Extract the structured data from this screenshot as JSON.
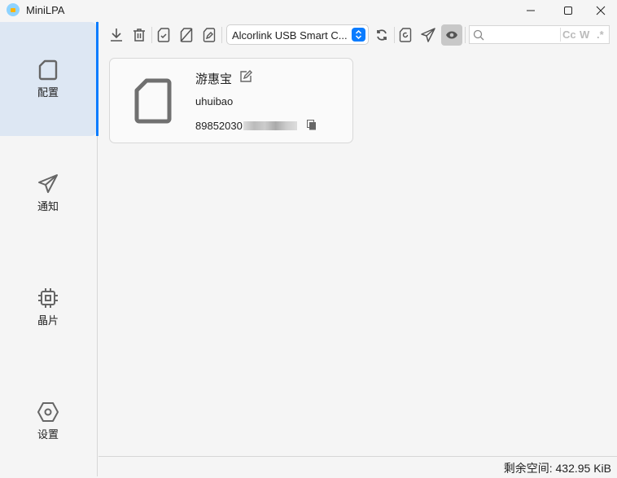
{
  "app": {
    "title": "MiniLPA"
  },
  "sidebar": {
    "items": [
      {
        "label": "配置",
        "icon": "sim-card-icon",
        "active": true
      },
      {
        "label": "通知",
        "icon": "send-icon"
      },
      {
        "label": "晶片",
        "icon": "chip-icon"
      },
      {
        "label": "设置",
        "icon": "settings-icon"
      }
    ]
  },
  "toolbar": {
    "reader": "Alcorlink USB Smart C...",
    "search_placeholder": "",
    "search_options": [
      "Cc",
      "W",
      ".*"
    ]
  },
  "profile": {
    "nickname": "游惠宝",
    "provider": "uhuibao",
    "iccid": "89852030"
  },
  "status": {
    "label": "剩余空间:",
    "value": "432.95 KiB"
  },
  "colors": {
    "accent": "#0a7cff",
    "active_nav": "#dde7f3"
  }
}
